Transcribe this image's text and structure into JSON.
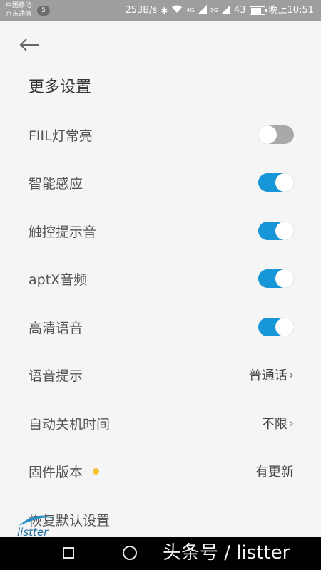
{
  "status_bar": {
    "carrier1": "中国移动",
    "carrier2": "京东通信",
    "sim_badge": "5",
    "network_speed": "253B/s",
    "signal_4g": "4G",
    "signal_3g": "3G",
    "battery_percent": "43",
    "time": "晚上10:51"
  },
  "header": {
    "title": "更多设置"
  },
  "settings": {
    "items": [
      {
        "label": "FIIL灯常亮",
        "type": "toggle",
        "on": false
      },
      {
        "label": "智能感应",
        "type": "toggle",
        "on": true
      },
      {
        "label": "触控提示音",
        "type": "toggle",
        "on": true
      },
      {
        "label": "aptX音频",
        "type": "toggle",
        "on": true
      },
      {
        "label": "高清语音",
        "type": "toggle",
        "on": true
      },
      {
        "label": "语音提示",
        "type": "select",
        "value": "普通话"
      },
      {
        "label": "自动关机时间",
        "type": "select",
        "value": "不限"
      },
      {
        "label": "固件版本",
        "type": "info",
        "value": "有更新",
        "badge_color": "#f3c22e"
      },
      {
        "label": "恢复默认设置",
        "type": "action"
      }
    ]
  },
  "watermark": {
    "text": "头条号 / listter",
    "logo_text": "listter"
  },
  "colors": {
    "accent": "#1796d8",
    "toggle_off": "#a9a9a9",
    "update_dot": "#f3c22e"
  }
}
